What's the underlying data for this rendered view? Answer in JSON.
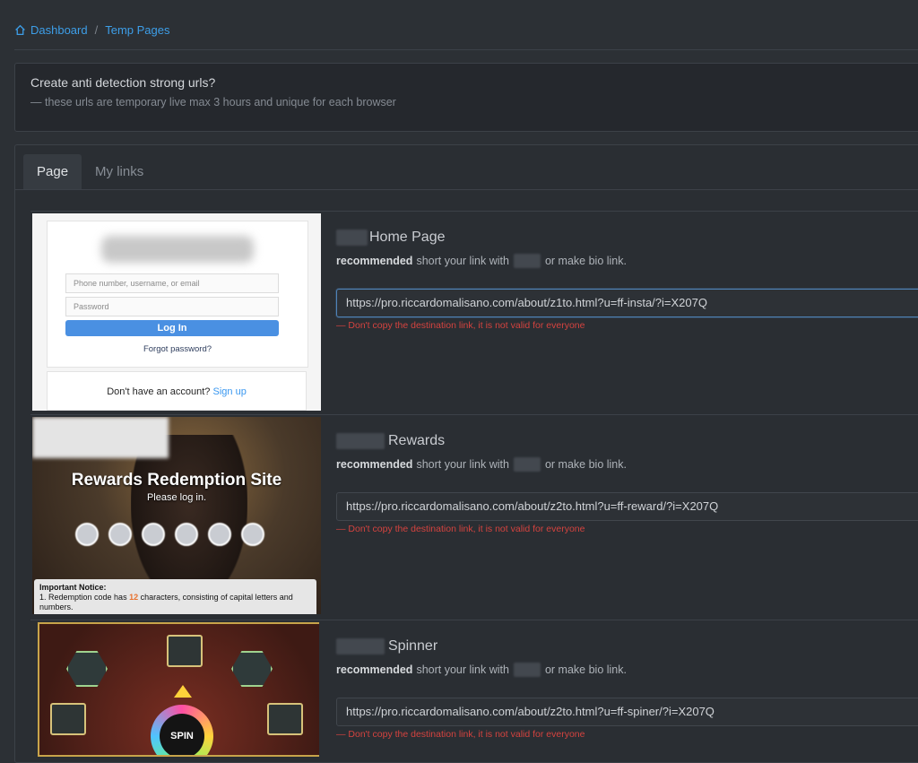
{
  "breadcrumb": {
    "home": "Dashboard",
    "separator": "/",
    "current": "Temp Pages"
  },
  "info": {
    "title": "Create anti detection strong urls?",
    "subtitle": "— these urls are temporary live max 3 hours and unique for each browser"
  },
  "tabs": [
    {
      "label": "Page",
      "active": true
    },
    {
      "label": "My links",
      "active": false
    }
  ],
  "common": {
    "recommended": "recommended",
    "short_text": "short your link with",
    "bio_text": "or make bio link.",
    "warning": "— Don't copy the destination link, it is not valid for everyone"
  },
  "items": [
    {
      "title": "Home Page",
      "url": "https://pro.riccardomalisano.com/about/z1to.html?u=ff-insta/?i=X207Q"
    },
    {
      "title": "Rewards",
      "url": "https://pro.riccardomalisano.com/about/z2to.html?u=ff-reward/?i=X207Q"
    },
    {
      "title": "Spinner",
      "url": "https://pro.riccardomalisano.com/about/z2to.html?u=ff-spiner/?i=X207Q"
    }
  ],
  "thumb_login": {
    "phone_placeholder": "Phone number, username, or email",
    "password_placeholder": "Password",
    "login_button": "Log In",
    "forgot": "Forgot password?",
    "no_account": "Don't have an account?",
    "signup": "Sign up"
  },
  "thumb_rewards": {
    "heading": "Rewards Redemption Site",
    "sub": "Please log in.",
    "notice_title": "Important Notice:",
    "notice_pre": "1. Redemption code has",
    "notice_num": "12",
    "notice_post": "characters, consisting of capital letters and numbers."
  },
  "thumb_spinner": {
    "spin_label": "SPIN"
  },
  "colors": {
    "accent": "#3d9ee8",
    "warning": "#d4433f",
    "background": "#2c3035"
  }
}
